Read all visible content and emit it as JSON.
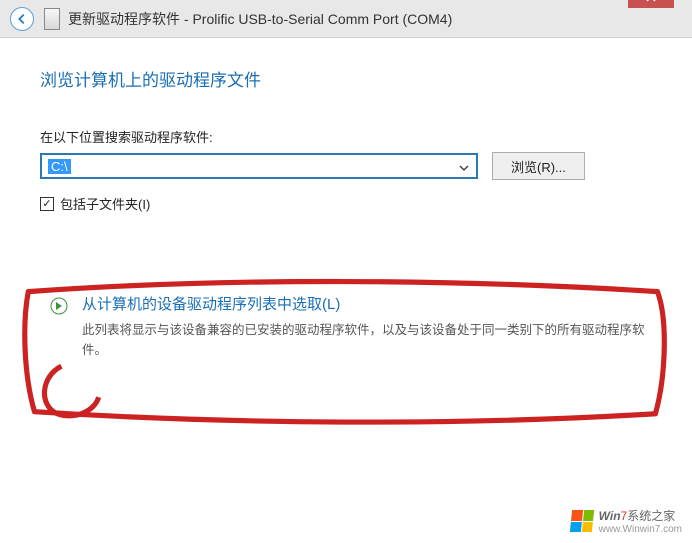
{
  "titlebar": {
    "title": "更新驱动程序软件 - Prolific USB-to-Serial Comm Port (COM4)"
  },
  "heading": "浏览计算机上的驱动程序文件",
  "search_label": "在以下位置搜索驱动程序软件:",
  "path_value": "C:\\",
  "browse_label": "浏览(R)...",
  "include_subfolders_label": "包括子文件夹(I)",
  "option": {
    "title": "从计算机的设备驱动程序列表中选取(L)",
    "desc": "此列表将显示与该设备兼容的已安装的驱动程序软件，以及与该设备处于同一类别下的所有驱动程序软件。"
  },
  "watermark": {
    "brand_prefix": "Win",
    "brand_num": "7",
    "brand_suffix": "系统之家",
    "url": "www.Winwin7.com"
  }
}
